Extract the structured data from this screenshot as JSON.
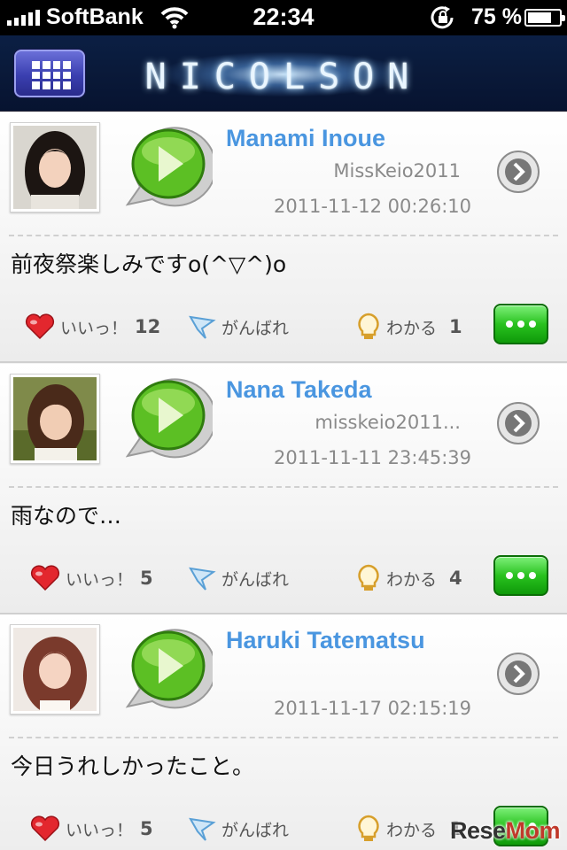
{
  "status_bar": {
    "carrier": "SoftBank",
    "time": "22:34",
    "battery_pct": "75 %",
    "battery_level": 0.75
  },
  "header": {
    "logo": "NICOLSON",
    "menu_icon": "grid-menu-icon"
  },
  "colors": {
    "name_blue": "#4a96e0",
    "accent_green": "#29c21f",
    "header_navy": "#0a1a3a"
  },
  "posts": [
    {
      "name": "Manami Inoue",
      "handle": "MissKeio2011",
      "date": "2011-11-12 00:26:10",
      "message": "前夜祭楽しみですo(^▽^)o",
      "likes_label": "いいっ！",
      "likes": "12",
      "cheer_label": "がんばれ",
      "understand_label": "わかる",
      "understand": "1"
    },
    {
      "name": "Nana Takeda",
      "handle": "misskeio2011...",
      "date": "2011-11-11 23:45:39",
      "message": "雨なので…",
      "likes_label": "いいっ！",
      "likes": "5",
      "cheer_label": "がんばれ",
      "understand_label": "わかる",
      "understand": "4"
    },
    {
      "name": "Haruki Tatematsu",
      "handle": "",
      "date": "2011-11-17 02:15:19",
      "message": "今日うれしかったこと。",
      "likes_label": "いいっ！",
      "likes": "5",
      "cheer_label": "がんばれ",
      "understand_label": "わかる",
      "understand": "1"
    }
  ],
  "watermark": {
    "part1": "Rese",
    "part2": "Mom"
  }
}
